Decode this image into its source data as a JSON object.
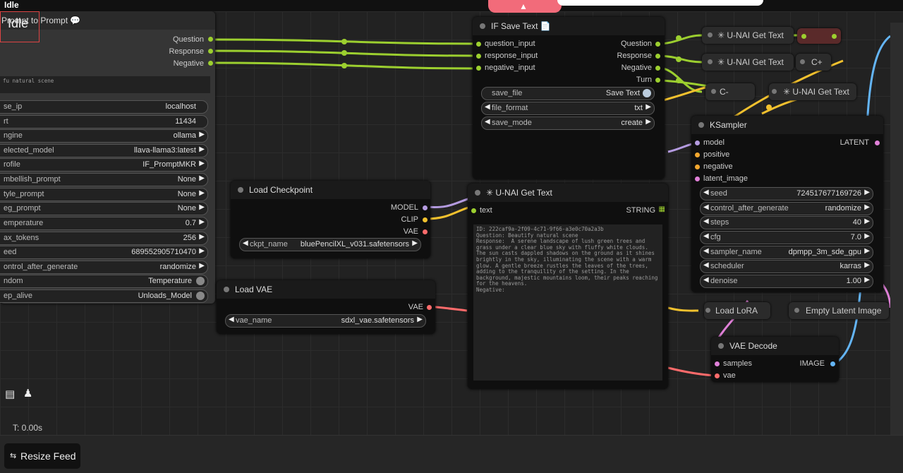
{
  "app": {
    "status_title": "Idle",
    "idle_overlay": "Idle",
    "timer": "T: 0.00s",
    "resize_feed_label": "Resize Feed"
  },
  "colors": {
    "accent_queue": "#f26b7a",
    "wire_green": "#9ccf2f",
    "wire_yellow": "#f2c12e",
    "wire_purple": "#b49be0",
    "wire_pink": "#e080d8",
    "wire_red": "#ff6b6b",
    "wire_blue": "#64b5f6"
  },
  "prompt_node": {
    "title": "Prompt to Prompt",
    "outputs": [
      "Question",
      "Response",
      "Negative"
    ],
    "input_text": "fu natural scene",
    "widgets": [
      {
        "name": "se_ip",
        "value": "localhost"
      },
      {
        "name": "rt",
        "value": "11434"
      },
      {
        "name": "ngine",
        "value": "ollama"
      },
      {
        "name": "elected_model",
        "value": "llava-llama3:latest"
      },
      {
        "name": "rofile",
        "value": "IF_PromptMKR"
      },
      {
        "name": "mbellish_prompt",
        "value": "None"
      },
      {
        "name": "tyle_prompt",
        "value": "None"
      },
      {
        "name": "eg_prompt",
        "value": "None"
      },
      {
        "name": "emperature",
        "value": "0.7"
      },
      {
        "name": "ax_tokens",
        "value": "256"
      },
      {
        "name": "eed",
        "value": "689552905710470"
      },
      {
        "name": "ontrol_after_generate",
        "value": "randomize"
      },
      {
        "name": "ndom",
        "value": "Temperature"
      },
      {
        "name": "ep_alive",
        "value": "Unloads_Model"
      }
    ]
  },
  "save_text_node": {
    "title": "IF Save Text",
    "inputs": [
      "question_input",
      "response_input",
      "negative_input"
    ],
    "outputs": [
      "Question",
      "Response",
      "Negative",
      "Turn"
    ],
    "widgets": [
      {
        "name": "save_file",
        "value": "Save Text"
      },
      {
        "name": "file_format",
        "value": "txt"
      },
      {
        "name": "save_mode",
        "value": "create"
      }
    ]
  },
  "checkpoint_node": {
    "title": "Load Checkpoint",
    "outputs": [
      "MODEL",
      "CLIP",
      "VAE"
    ],
    "widget": {
      "name": "ckpt_name",
      "value": "bluePencilXL_v031.safetensors"
    }
  },
  "vae_node": {
    "title": "Load VAE",
    "outputs": [
      "VAE"
    ],
    "widget": {
      "name": "vae_name",
      "value": "sdxl_vae.safetensors"
    }
  },
  "get_text_node": {
    "title": "U-NAI Get Text",
    "input": "text",
    "output": "STRING",
    "text": "ID: 222caf9a-2f09-4c71-9f66-a3e0c70a2a3b\nQuestion: Beautify natural scene\nResponse:  A serene landscape of lush green trees and grass under a clear blue sky with fluffy white clouds. The sun casts dappled shadows on the ground as it shines brightly in the sky, illuminating the scene with a warm glow. A gentle breeze rustles the leaves of the trees, adding to the tranquility of the setting. In the background, majestic mountains loom, their peaks reaching for the heavens.\nNegative:"
  },
  "ksampler_node": {
    "title": "KSampler",
    "inputs": [
      "model",
      "positive",
      "negative",
      "latent_image"
    ],
    "output": "LATENT",
    "widgets": [
      {
        "name": "seed",
        "value": "724517677169726"
      },
      {
        "name": "control_after_generate",
        "value": "randomize"
      },
      {
        "name": "steps",
        "value": "40"
      },
      {
        "name": "cfg",
        "value": "7.0"
      },
      {
        "name": "sampler_name",
        "value": "dpmpp_3m_sde_gpu"
      },
      {
        "name": "scheduler",
        "value": "karras"
      },
      {
        "name": "denoise",
        "value": "1.00"
      }
    ]
  },
  "vae_decode_node": {
    "title": "VAE Decode",
    "inputs": [
      "samples",
      "vae"
    ],
    "output": "IMAGE"
  },
  "mini_nodes": {
    "get_text_1": "U-NAI Get Text",
    "get_text_2": "U-NAI Get Text",
    "get_text_3": "U-NAI Get Text",
    "c_plus": "C+",
    "c_minus": "C-",
    "load_lora": "Load LoRA",
    "empty_latent": "Empty Latent Image"
  }
}
